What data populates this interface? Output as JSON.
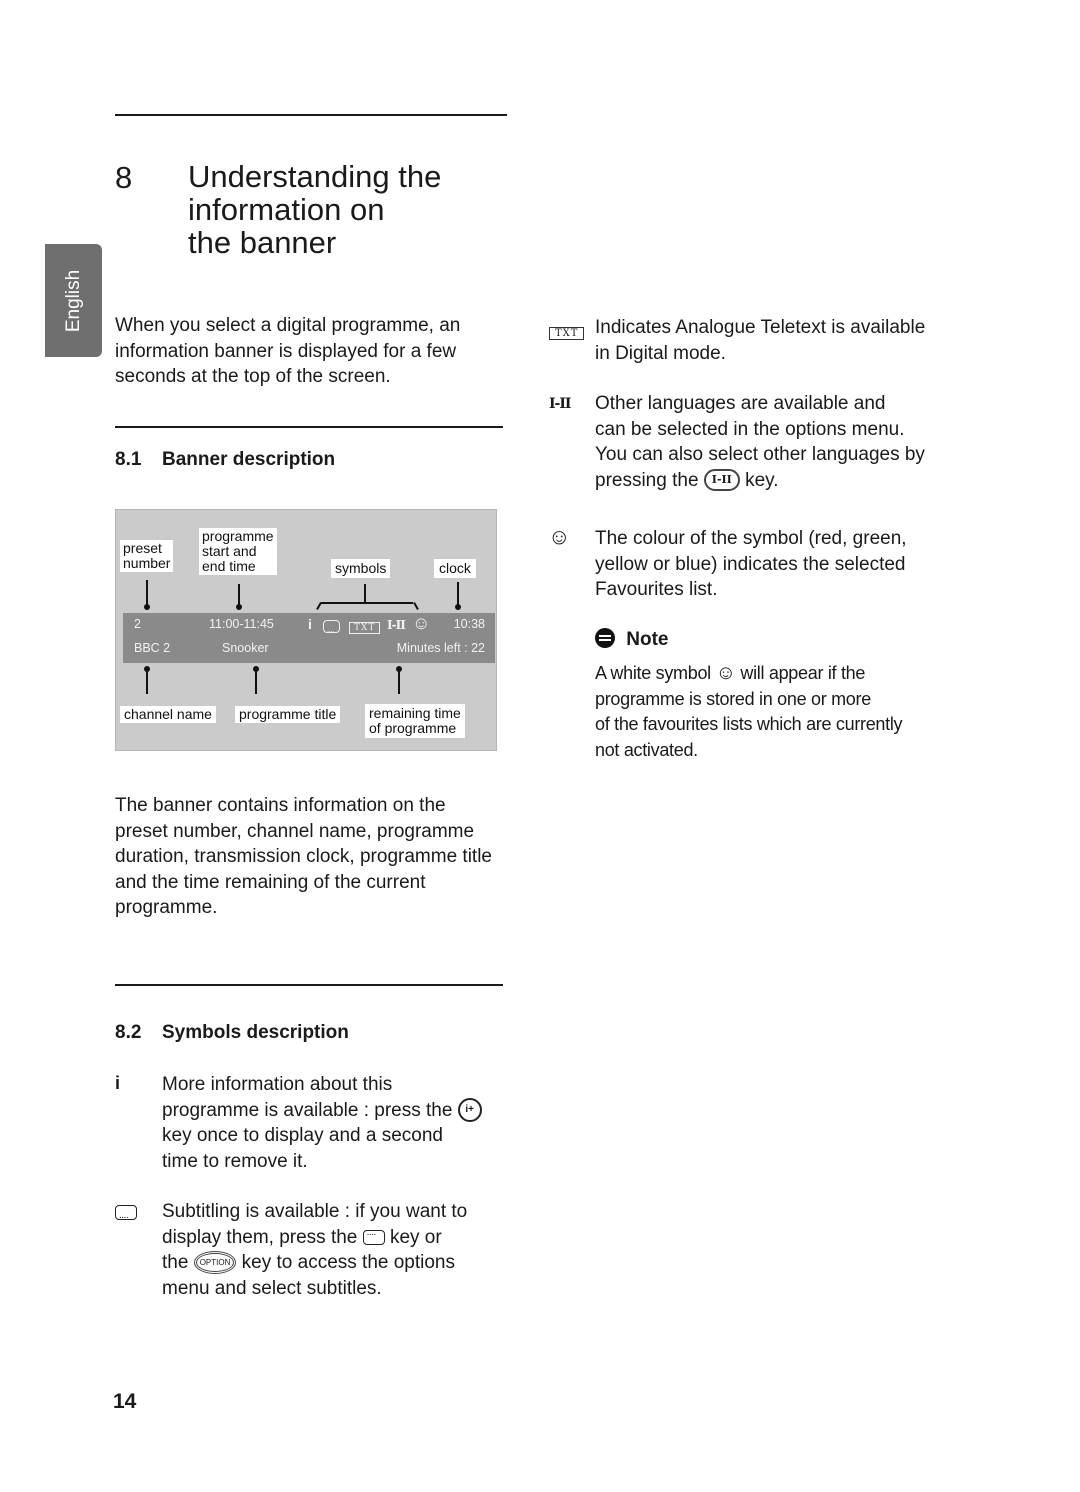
{
  "language_tab": "English",
  "chapter": {
    "number": "8",
    "title_lines": [
      "Understanding the",
      "information on",
      "the banner"
    ]
  },
  "intro_lines": [
    "When you select a digital programme, an",
    "information banner is displayed for a few",
    "seconds at the top of the screen."
  ],
  "section_8_1": {
    "number": "8.1",
    "title": "Banner description"
  },
  "banner_diagram": {
    "labels": {
      "preset_number": [
        "preset",
        "number"
      ],
      "start_end_time": [
        "programme",
        "start and",
        "end time"
      ],
      "symbols": "symbols",
      "clock": "clock",
      "channel_name": "channel name",
      "programme_title": "programme title",
      "remaining_time": [
        "remaining time",
        "of programme"
      ]
    },
    "bar": {
      "preset": "2",
      "time_range": "11:00-11:45",
      "info_symbol": "i",
      "txt_symbol": "TXT",
      "lang_symbol": "I-II",
      "fav_symbol": "☺",
      "clock": "10:38",
      "channel": "BBC 2",
      "title": "Snooker",
      "minutes_left": "Minutes left : 22"
    }
  },
  "banner_summary_lines": [
    "The banner contains information on the",
    "preset number, channel name, programme",
    "duration, transmission clock, programme title",
    "and the time remaining of the current",
    "programme."
  ],
  "section_8_2": {
    "number": "8.2",
    "title": "Symbols description"
  },
  "symbols": {
    "info": {
      "symbol": "i",
      "lines": [
        "More information about this",
        "programme is available : press the",
        "key once to display and a second",
        "time to remove it."
      ],
      "key_label": "i+"
    },
    "subtitle": {
      "lines_1": "Subtitling is available : if you want to",
      "line_2_pre": "display them, press the",
      "line_2_post": "key or",
      "line_3_pre": "the",
      "option_key": "OPTION",
      "line_3_post": "key to access the options",
      "line_4": "menu and select subtitles."
    },
    "teletext": {
      "symbol": "TXT",
      "lines": [
        "Indicates Analogue Teletext is available",
        "in Digital mode."
      ]
    },
    "languages": {
      "symbol": "I-II",
      "lines": [
        "Other languages are available and",
        "can be selected in the options menu.",
        "You can also select other languages by"
      ],
      "last_pre": "pressing the",
      "key_label": "I-II",
      "last_post": "key."
    },
    "favourites": {
      "symbol": "☺",
      "lines": [
        "The colour of the symbol (red, green,",
        "yellow or blue) indicates the selected",
        "Favourites list."
      ]
    }
  },
  "note": {
    "title": "Note",
    "line1_pre": "A white symbol",
    "line1_symbol": "☺",
    "line1_post": "will appear if the",
    "lines": [
      "programme is stored in one or more",
      "of the favourites lists which are currently",
      "not activated."
    ]
  },
  "page_number": "14"
}
